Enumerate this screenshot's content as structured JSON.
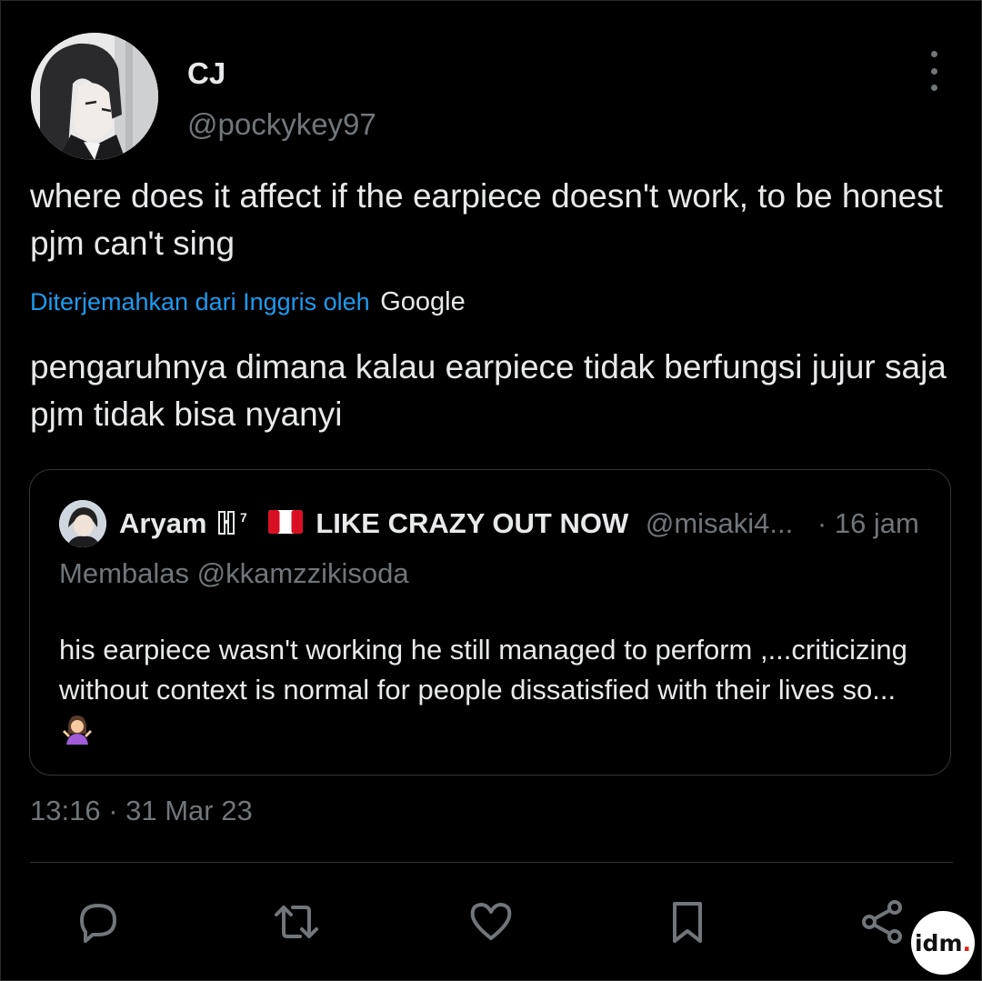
{
  "author": {
    "name": "CJ",
    "handle": "@pockykey97"
  },
  "tweet": {
    "text": "where does it affect if the earpiece doesn't work, to be honest pjm can't sing",
    "translation_label": "Diterjemahkan dari Inggris oleh",
    "translation_provider": "Google",
    "translated_text": "pengaruhnya dimana kalau earpiece tidak berfungsi jujur saja pjm tidak bisa nyanyi",
    "timestamp": "13:16 · 31 Mar 23"
  },
  "quote": {
    "name_prefix": "Aryam",
    "name_suffix": "LIKE CRAZY OUT NOW",
    "handle": "@misaki4...",
    "time": "· 16 jam",
    "reply_to": "Membalas @kkamzzikisoda",
    "text": "his earpiece wasn't working he still managed to perform  ,...criticizing without context is normal for people dissatisfied with their lives so...",
    "badge_text": "7"
  },
  "actions": {
    "reply_icon": "reply-icon",
    "retweet_icon": "retweet-icon",
    "like_icon": "heart-icon",
    "bookmark_icon": "bookmark-icon",
    "share_icon": "share-icon"
  },
  "watermark": {
    "main": "idm",
    "dot": "."
  },
  "colors": {
    "background": "#000000",
    "text": "#e7e9ea",
    "secondary": "#71767b",
    "link": "#1d9bf0",
    "border": "#333639"
  }
}
